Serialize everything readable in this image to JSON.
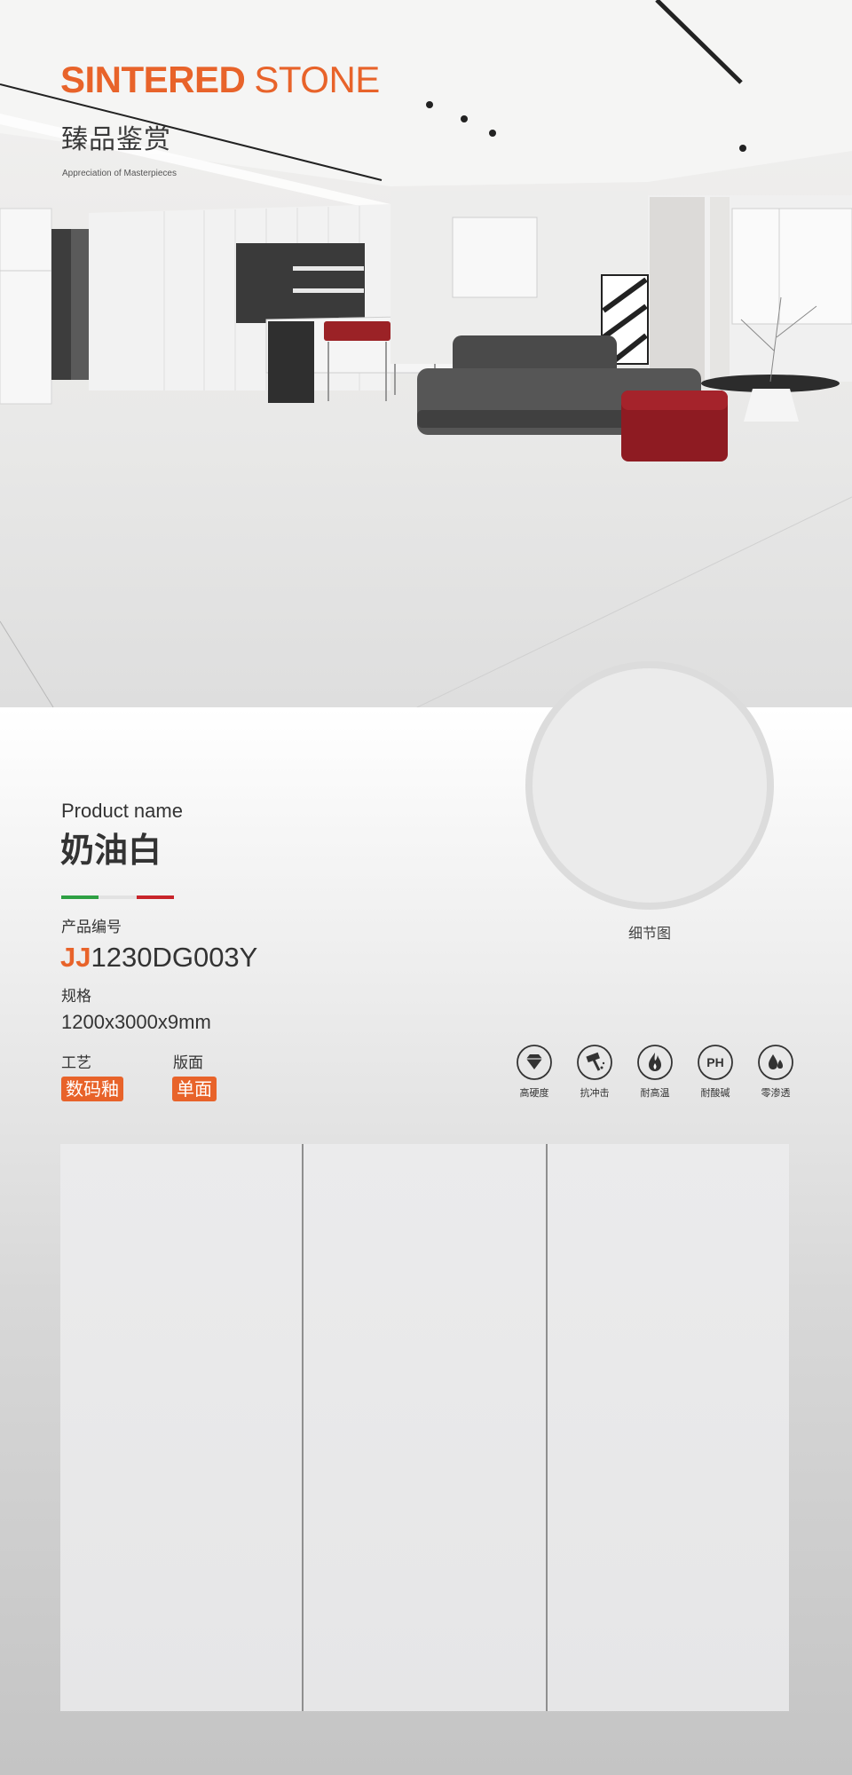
{
  "hero": {
    "brand_bold": "SINTERED",
    "brand_light": "STONE",
    "subtitle": "臻品鉴赏",
    "tagline": "Appreciation of Masterpieces"
  },
  "product": {
    "name_label": "Product name",
    "name": "奶油白",
    "code_label": "产品编号",
    "code_prefix": "JJ",
    "code_rest": "1230DG003Y",
    "spec_label": "规格",
    "spec": "1200x3000x9mm",
    "craft_label": "工艺",
    "craft": "数码釉",
    "face_label": "版面",
    "face": "单面",
    "detail_label": "细节图"
  },
  "features": [
    {
      "icon": "diamond-icon",
      "label": "高硬度"
    },
    {
      "icon": "hammer-icon",
      "label": "抗冲击"
    },
    {
      "icon": "flame-icon",
      "label": "耐高温"
    },
    {
      "icon": "ph-icon",
      "label": "耐酸碱",
      "icon_text": "PH"
    },
    {
      "icon": "droplet-icon",
      "label": "零渗透"
    }
  ],
  "colors": {
    "accent": "#e8632a",
    "flag_green": "#2ea043",
    "flag_red": "#c8242a",
    "text": "#333333"
  }
}
